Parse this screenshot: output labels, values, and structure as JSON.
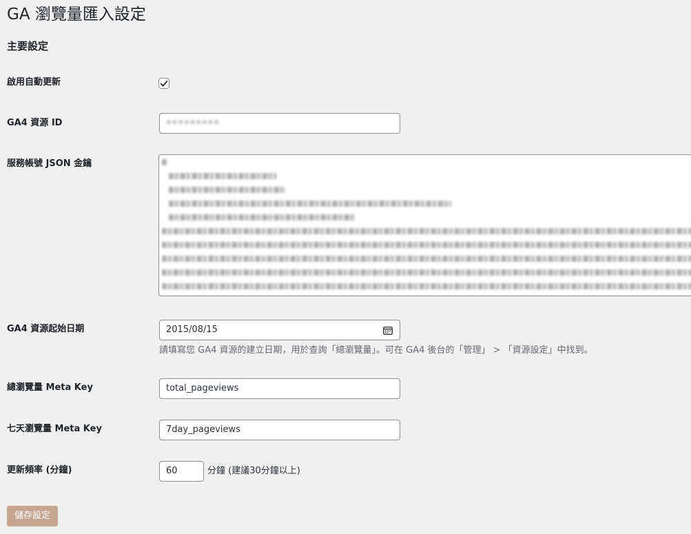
{
  "page": {
    "title": "GA 瀏覽量匯入設定",
    "section_title": "主要設定"
  },
  "fields": {
    "auto_update": {
      "label": "啟用自動更新",
      "checked": true
    },
    "property_id": {
      "label": "GA4 資源 ID",
      "value": "•••••••••"
    },
    "service_json": {
      "label": "服務帳號 JSON 金鑰"
    },
    "start_date": {
      "label": "GA4 資源起始日期",
      "value": "2015/08/15",
      "description": "請填寫您 GA4 資源的建立日期，用於查詢「總瀏覽量」。可在 GA4 後台的「管理」 > 「資源設定」中找到。"
    },
    "total_meta_key": {
      "label": "總瀏覽量 Meta Key",
      "value": "total_pageviews"
    },
    "seven_day_meta_key": {
      "label": "七天瀏覽量 Meta Key",
      "value": "7day_pageviews"
    },
    "frequency": {
      "label": "更新頻率 (分鐘)",
      "value": "60",
      "unit": "分鐘 (建議30分鐘以上)"
    }
  },
  "actions": {
    "save_label": "儲存設定"
  },
  "icons": {
    "checkbox": "check-icon",
    "date": "calendar-icon"
  },
  "colors": {
    "save_button": "#c6a690",
    "background": "#f0f0f1"
  }
}
